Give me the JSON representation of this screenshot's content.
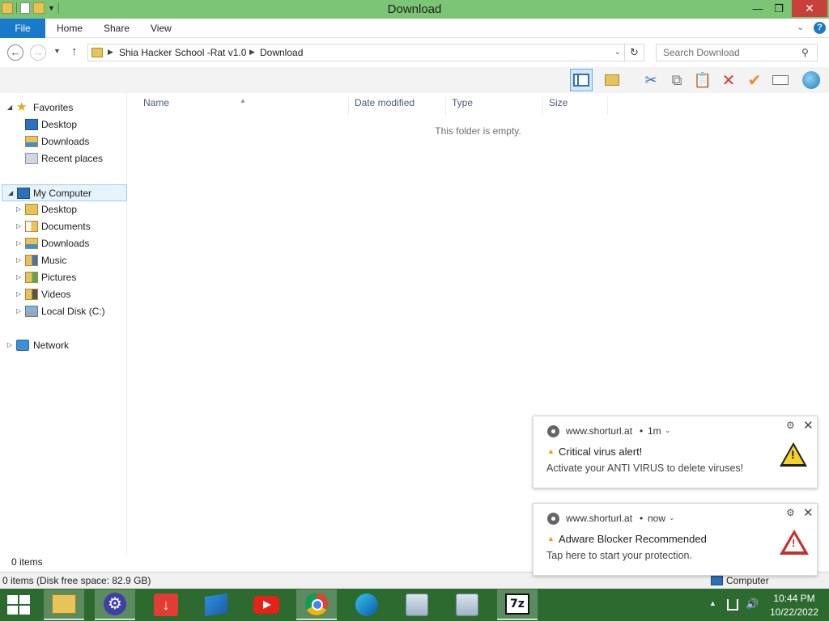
{
  "window": {
    "title": "Download",
    "min_glyph": "—",
    "max_glyph": "❐",
    "close_glyph": "✕"
  },
  "ribbon": {
    "tabs": [
      "File",
      "Home",
      "Share",
      "View"
    ],
    "collapse_glyph": "⌄",
    "help_glyph": "?"
  },
  "address": {
    "back_glyph": "←",
    "forward_glyph": "→",
    "recent_glyph": "▼",
    "up_glyph": "↑",
    "breadcrumbs": [
      "Shia Hacker School -Rat v1.0",
      "Download"
    ],
    "crumb_sep": "▶",
    "dropdown_glyph": "⌄",
    "refresh_glyph": "↻",
    "search_placeholder": "Search Download",
    "search_glyph": "⚲"
  },
  "toolbar": {
    "cut_glyph": "✂",
    "copy_glyph": "⧉",
    "paste_glyph": "📋",
    "delete_glyph": "✕",
    "check_glyph": "✔"
  },
  "nav": {
    "favorites": {
      "label": "Favorites",
      "items": [
        "Desktop",
        "Downloads",
        "Recent places"
      ]
    },
    "computer": {
      "label": "My Computer",
      "items": [
        "Desktop",
        "Documents",
        "Downloads",
        "Music",
        "Pictures",
        "Videos",
        "Local Disk (C:)"
      ]
    },
    "network": {
      "label": "Network"
    },
    "expand_open": "◢",
    "expand_closed": "▷"
  },
  "columns": {
    "name": "Name",
    "date": "Date modified",
    "type": "Type",
    "size": "Size",
    "sort_glyph": "▲"
  },
  "content": {
    "empty_message": "This folder is empty."
  },
  "status": {
    "item_count": "0 items",
    "disk_info": "0 items (Disk free space: 82.9 GB)",
    "zone": "Computer"
  },
  "notifications": [
    {
      "site": "www.shorturl.at",
      "dot": "•",
      "time": "1m",
      "chevron": "⌄",
      "gear": "⚙",
      "close": "✕",
      "small_icon": "▲",
      "title": "Critical virus alert!",
      "body": "Activate your ANTI VIRUS to delete viruses!",
      "big_icon_mark": "!"
    },
    {
      "site": "www.shorturl.at",
      "dot": "•",
      "time": "now",
      "chevron": "⌄",
      "gear": "⚙",
      "close": "✕",
      "small_icon": "▲",
      "title": "Adware Blocker Recommended",
      "body": "Tap here to start your protection.",
      "big_icon_mark": "!"
    }
  ],
  "taskbar": {
    "idm_glyph": "↓",
    "gear_glyph": "⚙",
    "sevenzip_label": "7z",
    "tray_chevron": "▲",
    "volume_glyph": "🔊",
    "time": "10:44 PM",
    "date": "10/22/2022"
  },
  "colors": {
    "titlebar": "#7cc576",
    "file_tab": "#1979ca",
    "taskbar": "#2c6a2f",
    "close_button": "#c7403a"
  }
}
